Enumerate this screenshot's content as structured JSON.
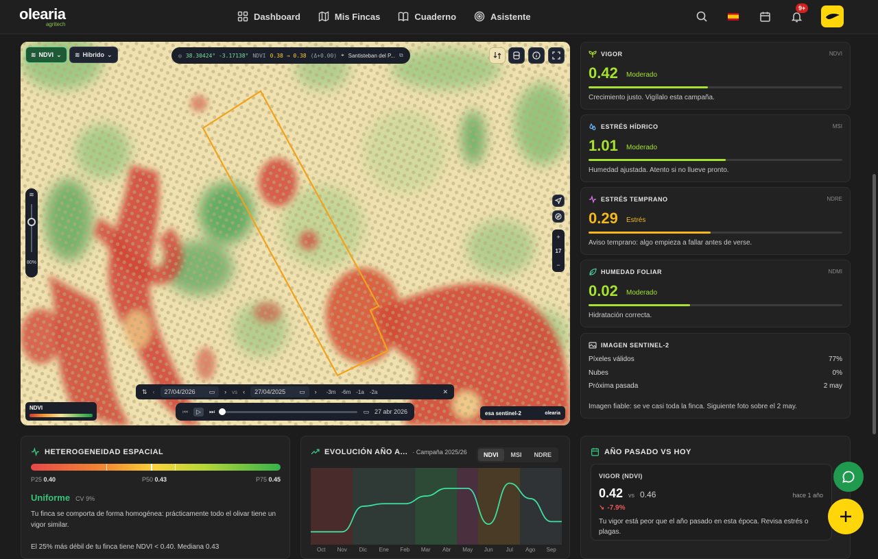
{
  "brand": {
    "name": "olearia",
    "sub": "agritech"
  },
  "nav": [
    {
      "label": "Dashboard",
      "icon": "grid-icon"
    },
    {
      "label": "Mis Fincas",
      "icon": "map-icon"
    },
    {
      "label": "Cuaderno",
      "icon": "book-icon"
    },
    {
      "label": "Asistente",
      "icon": "assistant-icon"
    }
  ],
  "topbar": {
    "notifications": "9+"
  },
  "map": {
    "layer_label": "NDVI",
    "base_label": "Híbrido",
    "coords": "38.30424° -3.17138°",
    "ndvi_prefix": "NDVI",
    "ndvi_value": "0.38 → 0.38",
    "ndvi_delta": "(Δ+0.00)",
    "location": "Santisteban del P...",
    "opacity": "80%",
    "zoom": "17",
    "date_from": "27/04/2026",
    "vs": "vs",
    "date_to": "27/04/2025",
    "ranges": [
      "-3m",
      "-6m",
      "-1a",
      "-2a"
    ],
    "play_date": "27 abr 2026",
    "legend_title": "NDVI",
    "credits_esa": "esa sentinel-2",
    "credits_brand": "olearia"
  },
  "cards": [
    {
      "title": "VIGOR",
      "tag": "NDVI",
      "value": "0.42",
      "level": "Moderado",
      "fill": 0.47,
      "color": "#a6e22e",
      "desc": "Crecimiento justo. Vigílalo esta campaña."
    },
    {
      "title": "ESTRÉS HÍDRICO",
      "tag": "MSI",
      "value": "1.01",
      "level": "Moderado",
      "fill": 0.54,
      "color": "#a6e22e",
      "desc": "Humedad ajustada. Atento si no llueve pronto."
    },
    {
      "title": "ESTRÉS TEMPRANO",
      "tag": "NDRE",
      "value": "0.29",
      "level": "Estrés",
      "fill": 0.48,
      "color": "#f5b71c",
      "desc": "Aviso temprano: algo empieza a fallar antes de verse."
    },
    {
      "title": "HUMEDAD FOLIAR",
      "tag": "NDMI",
      "value": "0.02",
      "level": "Moderado",
      "fill": 0.4,
      "color": "#a6e22e",
      "desc": "Hidratación correcta."
    }
  ],
  "sentinel": {
    "title": "IMAGEN SENTINEL-2",
    "rows": [
      {
        "label": "Píxeles válidos",
        "value": "77%"
      },
      {
        "label": "Nubes",
        "value": "0%"
      },
      {
        "label": "Próxima pasada",
        "value": "2 may"
      }
    ],
    "note": "Imagen fiable: se ve casi toda la finca. Siguiente foto sobre el 2 may."
  },
  "hetero": {
    "title": "HETEROGENEIDAD ESPACIAL",
    "p25_label": "P25",
    "p25": "0.40",
    "p50_label": "P50",
    "p50": "0.43",
    "p75_label": "P75",
    "p75": "0.45",
    "status": "Uniforme",
    "cv": "CV 9%",
    "desc": "Tu finca se comporta de forma homogénea: prácticamente todo el olivar tiene un vigor similar.",
    "extra": "El 25% más débil de tu finca tiene NDVI < 0.40. Mediana 0.43"
  },
  "evol": {
    "title": "EVOLUCIÓN AÑO A...",
    "season": "· Campaña 2025/26",
    "tabs": [
      "NDVI",
      "MSI",
      "NDRE"
    ],
    "months": [
      "Oct",
      "Nov",
      "Dic",
      "Ene",
      "Feb",
      "Mar",
      "Abr",
      "May",
      "Jun",
      "Jul",
      "Ago",
      "Sep"
    ]
  },
  "compare": {
    "title": "AÑO PASADO VS HOY",
    "metric": "VIGOR (NDVI)",
    "now": "0.42",
    "vs": "vs",
    "prev": "0.46",
    "when": "hace 1 año",
    "change": "-7.9%",
    "desc": "Tu vigor está peor que el año pasado en esta época. Revisa estrés o plagas."
  },
  "chart_data": {
    "type": "line",
    "title": "EVOLUCIÓN AÑO A...",
    "categories": [
      "Oct",
      "Nov",
      "Dic",
      "Ene",
      "Feb",
      "Mar",
      "Abr",
      "May",
      "Jun",
      "Jul",
      "Ago",
      "Sep"
    ],
    "series": [
      {
        "values": [
          0.3,
          0.3,
          0.4,
          0.41,
          0.41,
          0.44,
          0.47,
          0.47,
          0.33,
          0.49,
          0.43,
          0.34
        ]
      }
    ]
  },
  "colors": {
    "accent": "#a6e22e",
    "warning": "#f5b71c",
    "brand": "#ffd60a",
    "chat": "#1f9a4f"
  }
}
